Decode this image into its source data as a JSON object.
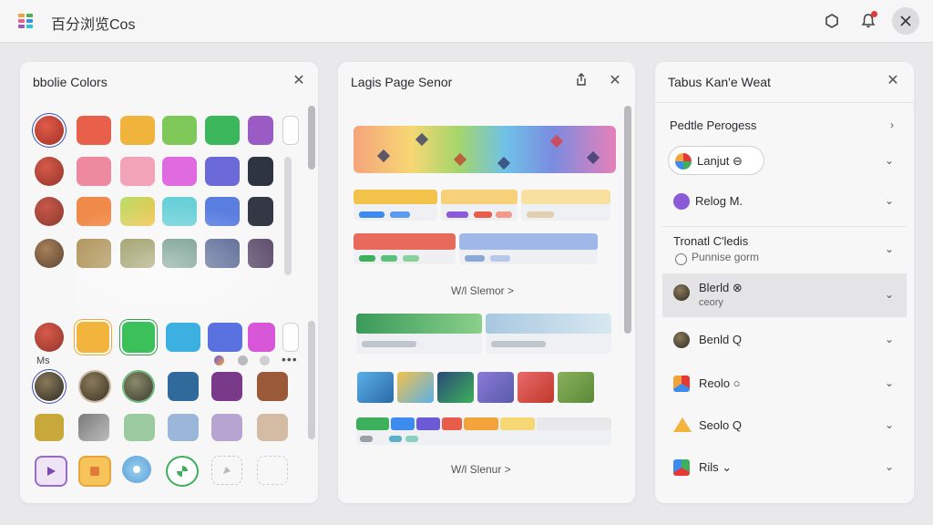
{
  "app": {
    "title": "百分浏览Cos"
  },
  "panels": {
    "colors": {
      "title": "bbolie Colors",
      "mini_label": "Ms"
    },
    "page": {
      "title": "Lagis Page Senor",
      "caption_1": "W/l Slemor >",
      "caption_2": "W/l Slenur >"
    },
    "list": {
      "title": "Tabus Kan'e Weat",
      "items": [
        {
          "label": "Pedtle Perogess",
          "chev": "›"
        },
        {
          "label": "Lanjut ⊖",
          "chev": "⌄"
        },
        {
          "label": "Relog M.",
          "chev": "⌄"
        },
        {
          "label": "Tronatl C'ledis",
          "sub": "Punnise gorm",
          "chev": "⌄"
        },
        {
          "label": "Blerld  ⊗",
          "sub": "ceory",
          "chev": "⌄"
        },
        {
          "label": "Benld  Q",
          "chev": "⌄"
        },
        {
          "label": "Reolo  ○",
          "chev": "⌄"
        },
        {
          "label": "Seolo  Q",
          "chev": "⌄"
        },
        {
          "label": "Rils ⌄",
          "chev": "⌄"
        }
      ]
    }
  },
  "colors": {
    "accent": "#3949ab",
    "notification": "#e53935"
  }
}
